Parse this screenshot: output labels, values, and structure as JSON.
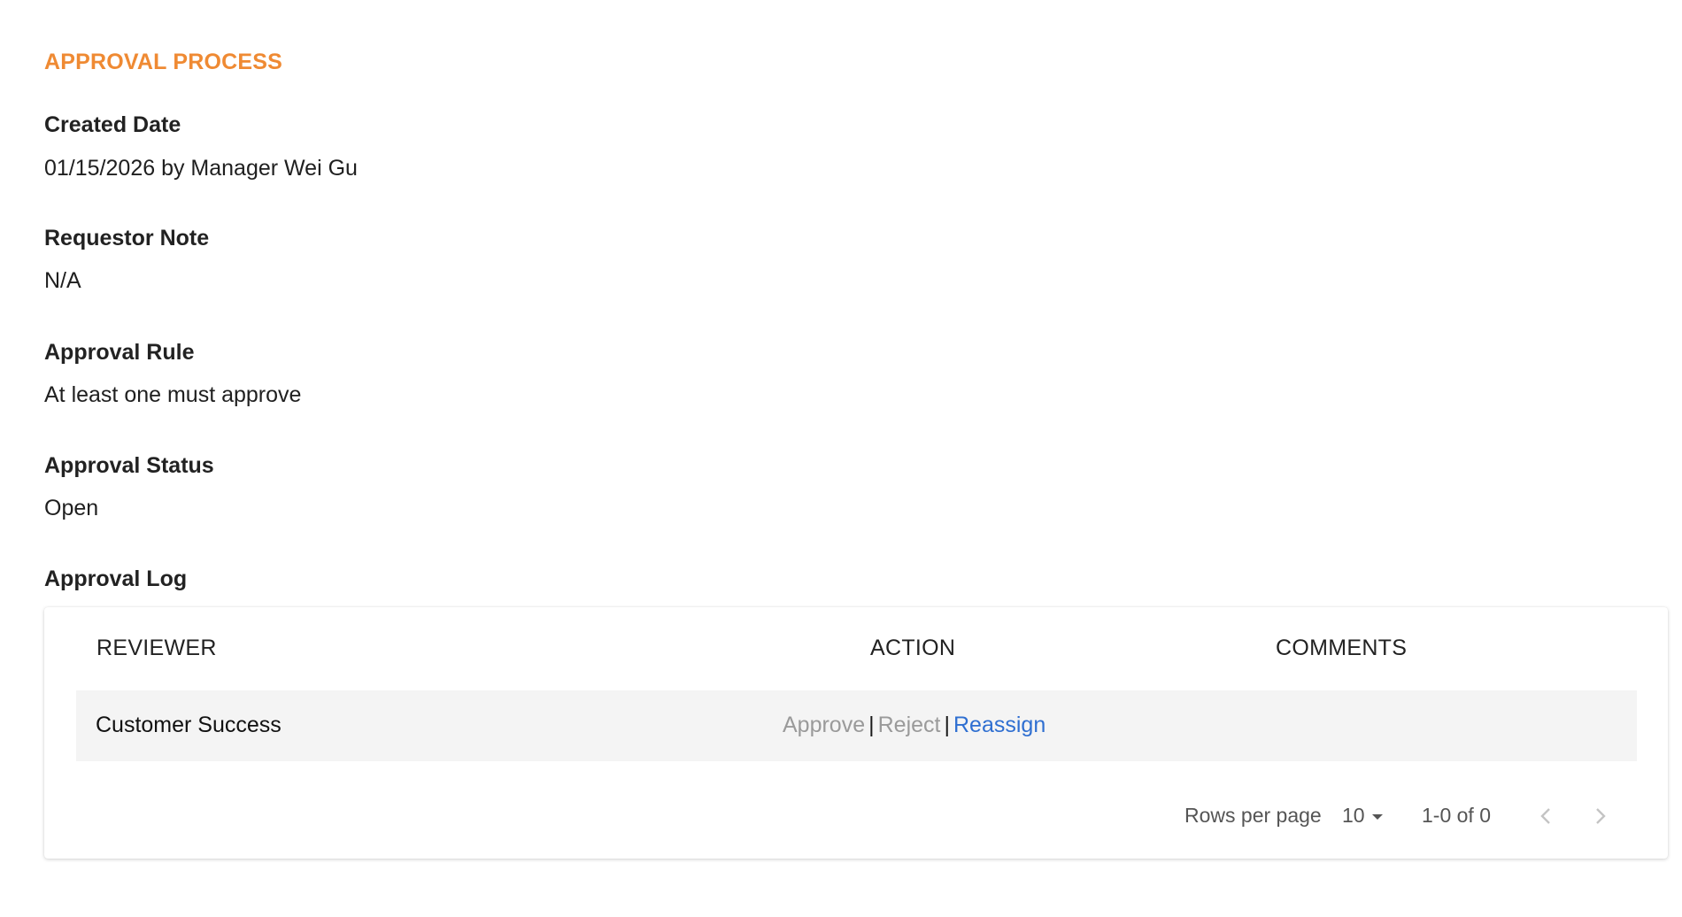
{
  "section": {
    "title": "APPROVAL PROCESS"
  },
  "fields": {
    "created_date": {
      "label": "Created Date",
      "value": "01/15/2026 by Manager Wei Gu"
    },
    "requestor_note": {
      "label": "Requestor Note",
      "value": "N/A"
    },
    "approval_rule": {
      "label": "Approval Rule",
      "value": "At least one must approve"
    },
    "approval_status": {
      "label": "Approval Status",
      "value": "Open"
    },
    "approval_log": {
      "label": "Approval Log"
    }
  },
  "table": {
    "columns": [
      "REVIEWER",
      "ACTION",
      "COMMENTS"
    ],
    "rows": [
      {
        "reviewer": "Customer Success",
        "actions": {
          "approve": "Approve",
          "reject": "Reject",
          "reassign": "Reassign",
          "separator": "|"
        },
        "comments": ""
      }
    ]
  },
  "pagination": {
    "rows_per_page_label": "Rows per page",
    "rows_per_page_value": "10",
    "range_text": "1-0 of 0",
    "prev_icon": "chevron-left-icon",
    "next_icon": "chevron-right-icon"
  },
  "colors": {
    "accent": "#ef8a33",
    "link": "#2f6fd1",
    "disabled": "#9a9a9a",
    "row_bg": "#f4f4f4"
  }
}
